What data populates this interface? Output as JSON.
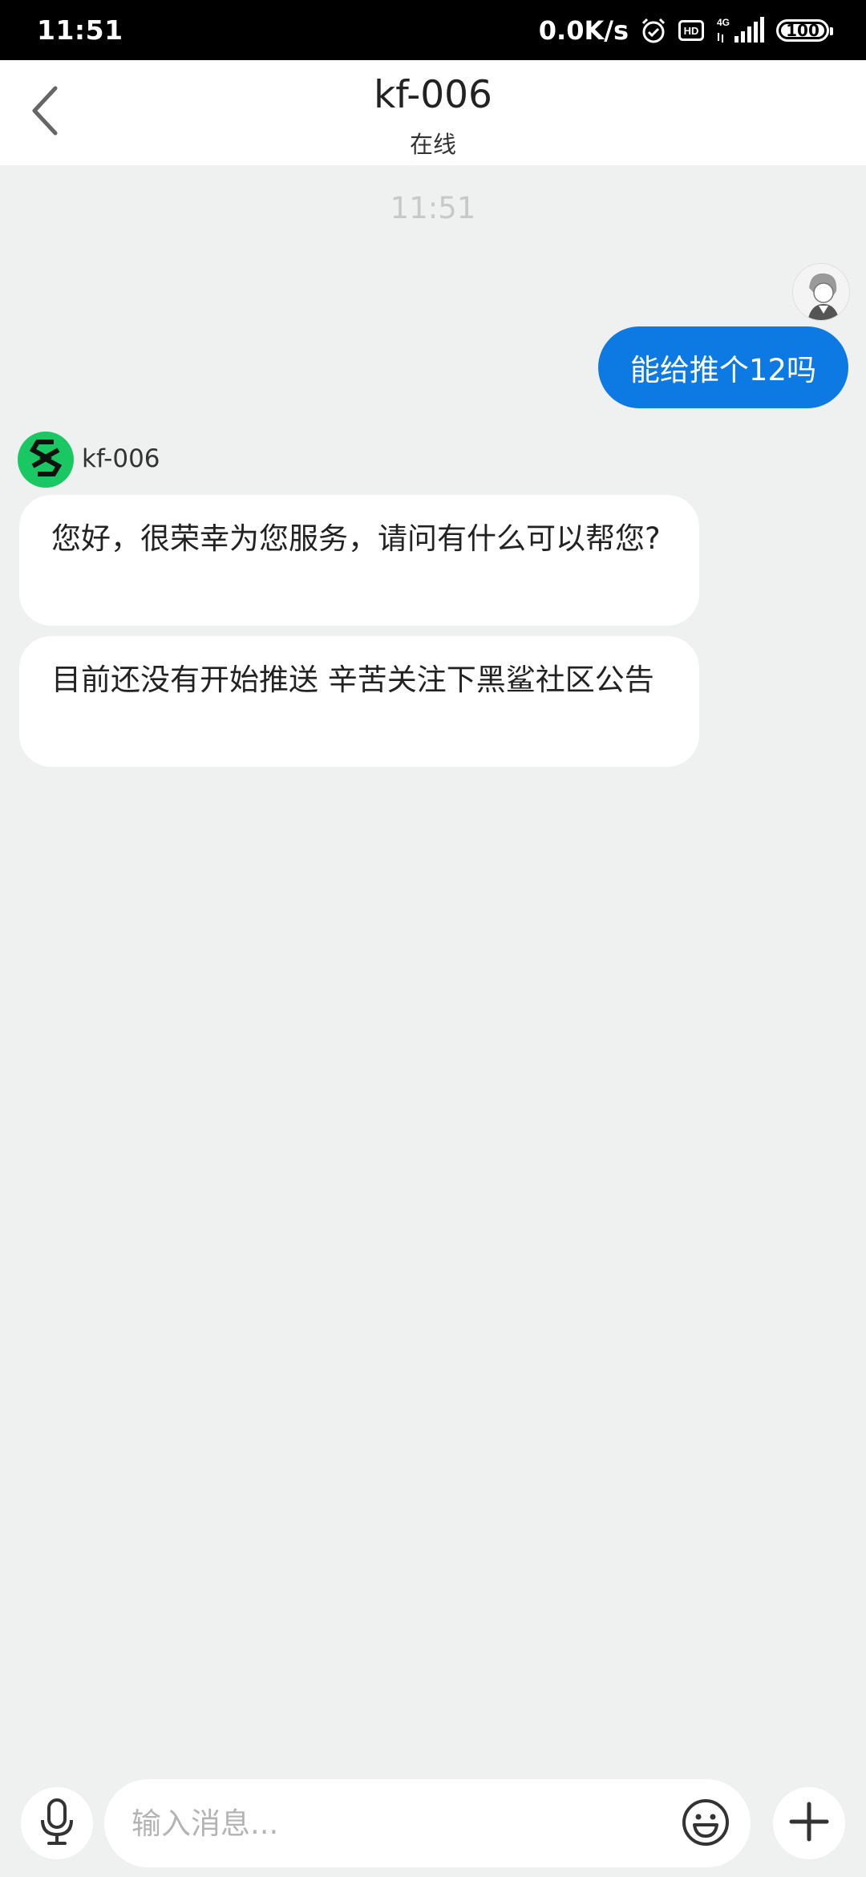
{
  "status_bar": {
    "time": "11:51",
    "net_speed": "0.0K/s",
    "network": "4G",
    "battery": "100",
    "icons": [
      "alarm-icon",
      "hd-icon",
      "signal-icon",
      "battery-icon"
    ]
  },
  "header": {
    "title": "kf-006",
    "status": "在线",
    "back_icon": "chevron-left-icon"
  },
  "chat": {
    "timestamp": "11:51",
    "messages": [
      {
        "sender": "user",
        "text": "能给推个12吗"
      },
      {
        "sender": "agent",
        "name": "kf-006",
        "text": "您好，很荣幸为您服务，请问有什么可以帮您?"
      },
      {
        "sender": "agent",
        "name": "kf-006",
        "text": "目前还没有开始推送 辛苦关注下黑鲨社区公告"
      }
    ]
  },
  "input_bar": {
    "placeholder": "输入消息...",
    "value": "",
    "icons": [
      "microphone-icon",
      "emoji-icon",
      "plus-icon"
    ]
  },
  "colors": {
    "user_bubble": "#0d7ae4",
    "agent_avatar": "#19c862",
    "background": "#eff0f0"
  }
}
